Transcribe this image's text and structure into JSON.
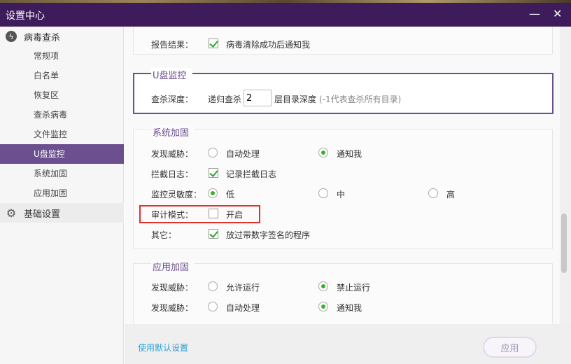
{
  "window": {
    "title": "设置中心",
    "minimize": "—",
    "close": "✕"
  },
  "sidebar": {
    "groups": [
      {
        "label": "病毒查杀",
        "icon": "lightning-icon"
      },
      {
        "label": "基础设置",
        "icon": "gear-icon"
      }
    ],
    "items": [
      "常规项",
      "白名单",
      "恢复区",
      "查杀病毒",
      "文件监控",
      "U盘监控",
      "系统加固",
      "应用加固"
    ],
    "selected": "U盘监控"
  },
  "report": {
    "label": "报告结果：",
    "checkbox": "病毒清除成功后通知我",
    "checked": true
  },
  "usb": {
    "title": "U盘监控",
    "label": "查杀深度：",
    "prefix": "递归查杀",
    "value": "2",
    "suffix": "层目录深度",
    "hint": "(-1代表查杀所有目录)"
  },
  "system": {
    "title": "系统加固",
    "threat_label": "发现威胁：",
    "threat_opts": [
      "自动处理",
      "通知我"
    ],
    "threat_sel": 1,
    "log_label": "拦截日志：",
    "log_cb": "记录拦截日志",
    "log_checked": true,
    "sens_label": "监控灵敏度：",
    "sens_opts": [
      "低",
      "中",
      "高"
    ],
    "sens_sel": 0,
    "audit_label": "审计模式：",
    "audit_cb": "开启",
    "audit_checked": false,
    "other_label": "其它：",
    "other_cb": "放过带数字签名的程序",
    "other_checked": true,
    "highlight_color": "#e03030"
  },
  "app": {
    "title": "应用加固",
    "r1_label": "发现威胁：",
    "r1_opts": [
      "允许运行",
      "禁止运行"
    ],
    "r1_sel": 1,
    "r2_label": "发现威胁：",
    "r2_opts": [
      "自动处理",
      "通知我"
    ],
    "r2_sel": 1
  },
  "footer": {
    "default_link": "使用默认设置",
    "apply": "应用"
  }
}
